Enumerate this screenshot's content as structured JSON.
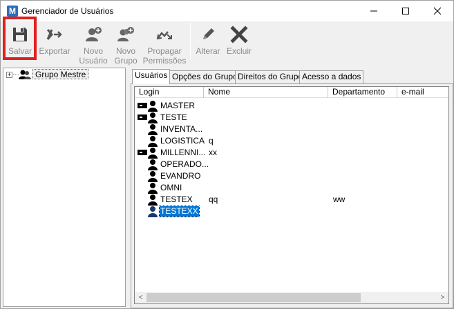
{
  "window": {
    "icon_letter": "M",
    "title": "Gerenciador de Usuários",
    "minimize": "—",
    "maximize": "☐",
    "close": "✕"
  },
  "toolbar": {
    "items": [
      {
        "label": "Salvar",
        "icon": "save-icon"
      },
      {
        "label": "Exportar",
        "icon": "export-icon"
      },
      {
        "label": "Novo\nUsuário",
        "line1": "Novo",
        "line2": "Usuário",
        "icon": "add-user-icon"
      },
      {
        "label": "Novo\nGrupo",
        "line1": "Novo",
        "line2": "Grupo",
        "icon": "add-group-icon"
      },
      {
        "label": "Propagar\nPermissões",
        "line1": "Propagar",
        "line2": "Permissões",
        "icon": "propagate-icon"
      },
      {
        "label": "Alterar",
        "icon": "edit-icon"
      },
      {
        "label": "Excluir",
        "icon": "delete-icon"
      }
    ],
    "highlight_color": "#e02020"
  },
  "tree": {
    "root_label": "Grupo Mestre",
    "expander": "+"
  },
  "tabs": [
    {
      "label": "Usuários",
      "active": true
    },
    {
      "label": "Opções do Grupo",
      "active": false
    },
    {
      "label": "Direitos do Grupo",
      "active": false
    },
    {
      "label": "Acesso a dados",
      "active": false
    }
  ],
  "list": {
    "columns": [
      "Login",
      "Nome",
      "Departamento",
      "e-mail"
    ],
    "rows": [
      {
        "login": "MASTER",
        "name": "",
        "dept": "",
        "expandable": true
      },
      {
        "login": "TESTE",
        "name": "",
        "dept": "",
        "expandable": true
      },
      {
        "login": "INVENTA...",
        "name": "",
        "dept": "",
        "expandable": false
      },
      {
        "login": "LOGISTICA",
        "name": "q",
        "dept": "",
        "expandable": false
      },
      {
        "login": "MILLENNI...",
        "name": "xx",
        "dept": "",
        "expandable": true
      },
      {
        "login": "OPERADO...",
        "name": "",
        "dept": "",
        "expandable": false
      },
      {
        "login": "EVANDRO",
        "name": "",
        "dept": "",
        "expandable": false
      },
      {
        "login": "OMNI",
        "name": "",
        "dept": "",
        "expandable": false
      },
      {
        "login": "TESTEX",
        "name": "qq",
        "dept": "ww",
        "expandable": false
      },
      {
        "login": "TESTEXX",
        "name": "",
        "dept": "",
        "expandable": false,
        "selected": true
      }
    ],
    "selection_color": "#0078d7"
  },
  "scrollbar": {
    "left_arrow": "<",
    "right_arrow": ">"
  }
}
